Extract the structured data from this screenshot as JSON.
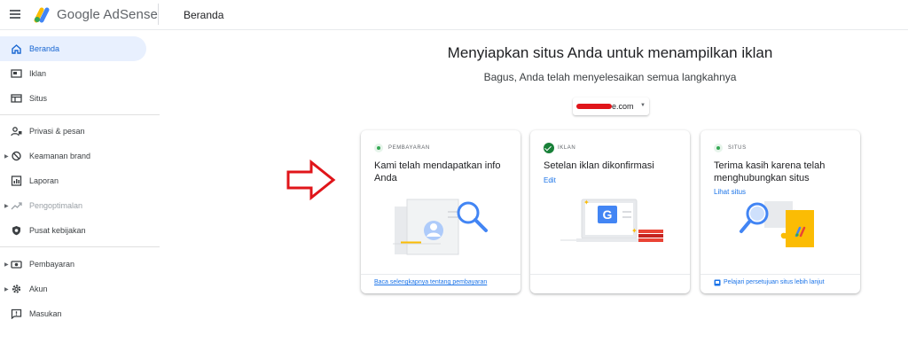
{
  "header": {
    "brand": "Google AdSense",
    "page_title": "Beranda"
  },
  "sidebar": {
    "items": [
      {
        "label": "Beranda",
        "icon": "home-icon",
        "active": true
      },
      {
        "label": "Iklan",
        "icon": "ads-icon"
      },
      {
        "label": "Situs",
        "icon": "sites-icon"
      },
      {
        "label": "Privasi & pesan",
        "icon": "privacy-icon"
      },
      {
        "label": "Keamanan brand",
        "icon": "block-icon",
        "expandable": true
      },
      {
        "label": "Laporan",
        "icon": "reports-icon"
      },
      {
        "label": "Pengoptimalan",
        "icon": "trending-icon",
        "expandable": true,
        "disabled": true
      },
      {
        "label": "Pusat kebijakan",
        "icon": "policy-icon"
      },
      {
        "label": "Pembayaran",
        "icon": "payments-icon",
        "expandable": true
      },
      {
        "label": "Akun",
        "icon": "gear-icon",
        "expandable": true
      },
      {
        "label": "Masukan",
        "icon": "feedback-icon"
      }
    ]
  },
  "main": {
    "headline": "Menyiapkan situs Anda untuk menampilkan iklan",
    "subline": "Bagus, Anda telah menyelesaikan semua langkahnya",
    "site_select": {
      "value": "e.com"
    },
    "cards": [
      {
        "status": "PEMBAYARAN",
        "title": "Kami telah mendapatkan info Anda",
        "footer": "Baca selengkapnya tentang pembayaran"
      },
      {
        "status": "IKLAN",
        "title": "Setelan iklan dikonfirmasi",
        "action": "Edit"
      },
      {
        "status": "SITUS",
        "title": "Terima kasih karena telah menghubungkan situs",
        "action": "Lihat situs",
        "footer": "Pelajari persetujuan situs lebih lanjut"
      }
    ]
  },
  "colors": {
    "accent": "#1a73e8",
    "active_bg": "#e8f0fe",
    "success": "#188038",
    "annotation_arrow": "#e0151a"
  }
}
